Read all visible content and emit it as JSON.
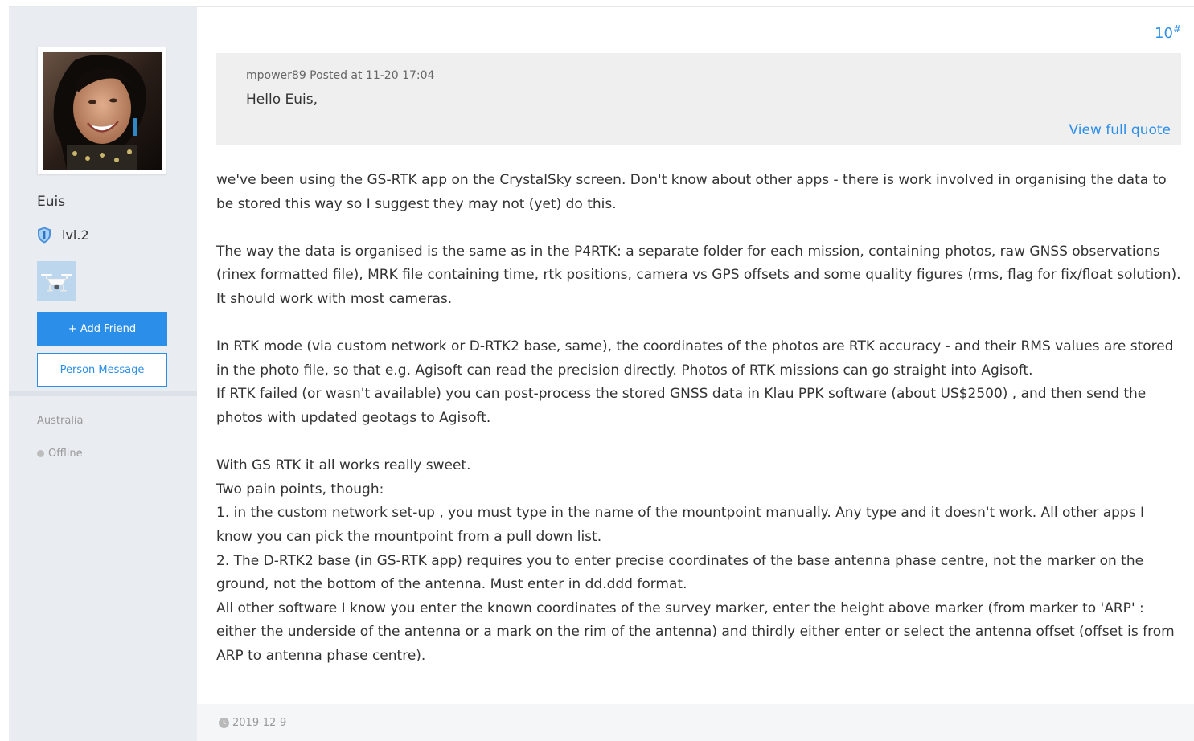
{
  "author": {
    "name": "Euis",
    "level": "lvl.2",
    "add_friend_label": "+ Add Friend",
    "message_label": "Person Message",
    "location": "Australia",
    "status": "Offline"
  },
  "post": {
    "floor": "10",
    "floor_mark": "#",
    "date": "2019-12-9"
  },
  "quote": {
    "meta": "mpower89 Posted at 11-20 17:04",
    "text": "Hello Euis,",
    "link": "View full quote"
  },
  "body": {
    "p1": "we've been using the GS-RTK app on the CrystalSky screen. Don't know about other apps - there is work involved in organising the data to be stored this way so I suggest they may not (yet) do this.",
    "p2": "The way the data is organised is the same as in the P4RTK: a separate folder for each mission, containing photos, raw GNSS observations (rinex formatted file), MRK file containing time, rtk positions, camera vs GPS offsets and some quality figures (rms, flag for fix/float solution). It should work with most cameras.",
    "p3": "In RTK mode (via custom network or D-RTK2 base, same), the coordinates of the photos are RTK accuracy - and their RMS values are stored in the photo file, so that e.g. Agisoft can read the precision directly. Photos of RTK missions can go straight into Agisoft.",
    "p4": "If RTK failed (or wasn't available) you can post-process the stored GNSS data in Klau PPK software (about US$2500) , and then send the photos with updated geotags to Agisoft.",
    "p5": "With GS RTK it all works really sweet.",
    "p6": "Two pain points, though:",
    "p7": "1. in the custom network set-up , you must type in the name of the mountpoint manually. Any type and it doesn't work. All other apps I know you can pick the mountpoint from a pull down list.",
    "p8": "2. The D-RTK2 base (in GS-RTK app) requires you to enter precise coordinates of the base antenna phase centre, not the marker on the ground, not the bottom of the antenna. Must enter in dd.ddd format.",
    "p9": "All other software I know you enter the known coordinates of the survey marker, enter the height above marker (from marker to 'ARP' : either the underside of the antenna or a mark on the rim of the antenna) and thirdly either enter or select the antenna offset (offset is from ARP to antenna phase centre)."
  },
  "colors": {
    "accent": "#2b8ee8",
    "sidebar_bg": "#e9edf2",
    "quote_bg": "#efefef",
    "muted_text": "#999999"
  },
  "icons": {
    "level_badge": "shield-icon",
    "medal": "drone-icon",
    "status": "offline-dot-icon",
    "date": "clock-icon"
  }
}
